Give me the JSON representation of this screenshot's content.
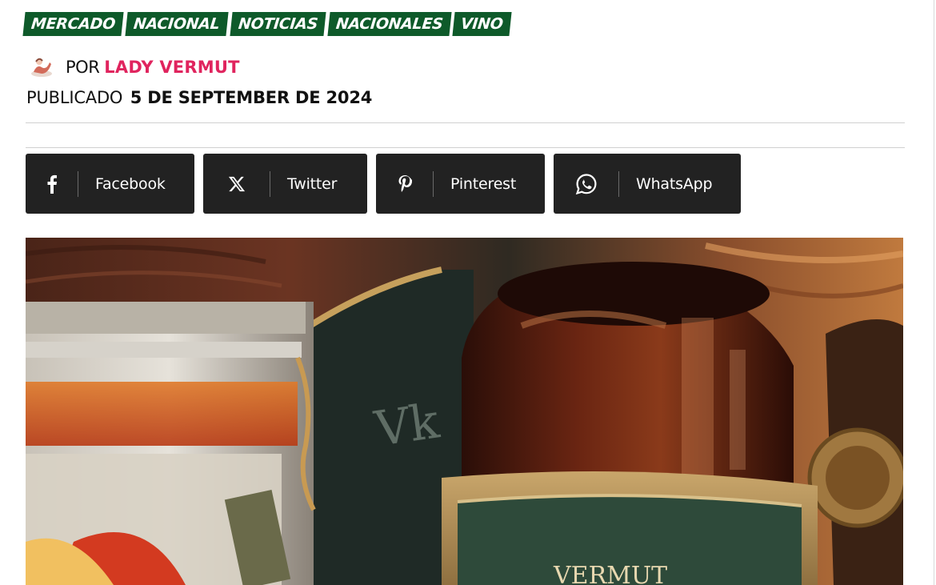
{
  "categories": [
    "MERCADO",
    "NACIONAL",
    "NOTICIAS",
    "NACIONALES",
    "VINO"
  ],
  "author": {
    "prefix": "POR",
    "name": "LADY VERMUT"
  },
  "published": {
    "prefix": "PUBLICADO",
    "date": "5 DE SEPTEMBER DE 2024"
  },
  "share": {
    "facebook": {
      "label": "Facebook",
      "icon": "facebook-icon"
    },
    "twitter": {
      "label": "Twitter",
      "icon": "x-icon"
    },
    "pinterest": {
      "label": "Pinterest",
      "icon": "pinterest-icon"
    },
    "whatsapp": {
      "label": "WhatsApp",
      "icon": "whatsapp-icon"
    }
  },
  "hero_image": {
    "label_text": "VERMUT"
  },
  "colors": {
    "category_bg": "#0e5a2a",
    "author_link": "#e0245e",
    "share_bg": "#222222"
  }
}
